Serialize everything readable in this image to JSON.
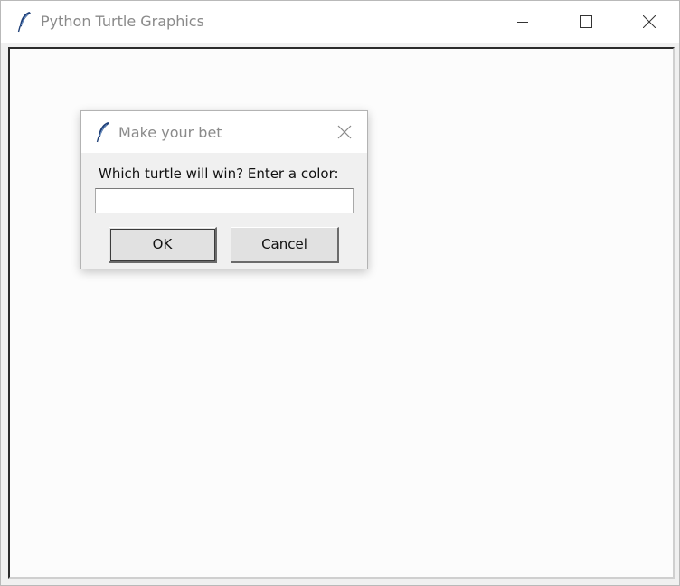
{
  "window": {
    "title": "Python Turtle Graphics",
    "icon": "feather-icon",
    "controls": [
      "minimize-icon",
      "maximize-icon",
      "close-icon"
    ]
  },
  "dialog": {
    "title": "Make your bet",
    "icon": "feather-icon",
    "prompt": "Which turtle will win? Enter a color:",
    "input_value": "",
    "ok_label": "OK",
    "cancel_label": "Cancel"
  },
  "colors": {
    "titlebar": "#ffffff",
    "title_text": "#8a8a8a",
    "canvas": "#fcfcfc",
    "dialog_body": "#f0f0f0",
    "feather": "#1f3f77"
  }
}
